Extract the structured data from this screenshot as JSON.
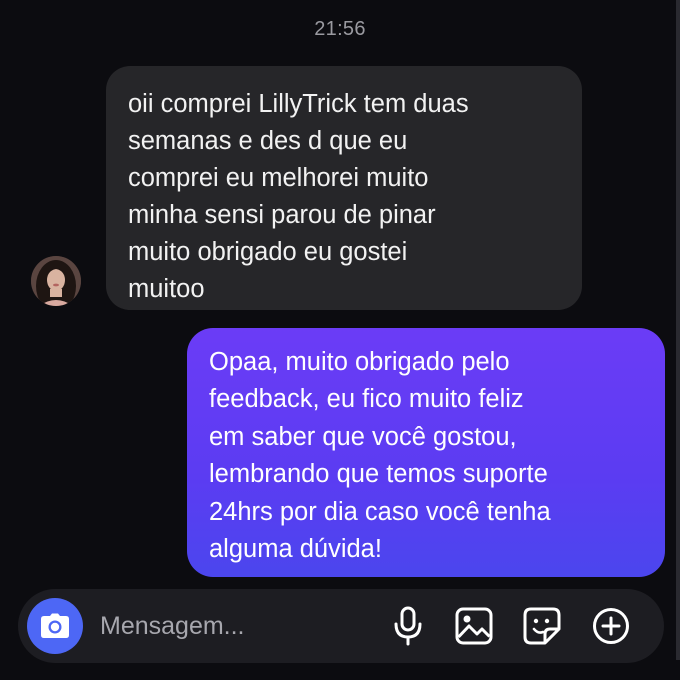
{
  "thread": {
    "timestamp": "21:56"
  },
  "messages": [
    {
      "direction": "incoming",
      "text": "oii comprei LillyTrick tem duas\nsemanas e des d que eu\ncomprei eu melhorei muito\nminha sensi parou de pinar\nmuito obrigado eu gostei\nmuitoo"
    },
    {
      "direction": "outgoing",
      "text": "Opaa, muito obrigado pelo\nfeedback, eu fico muito feliz\nem saber que você gostou,\nlembrando que temos suporte\n24hrs por dia caso você tenha\nalguma dúvida!"
    }
  ],
  "composer": {
    "placeholder": "Mensagem...",
    "value": "",
    "icons": [
      "camera-icon",
      "microphone-icon",
      "gallery-icon",
      "sticker-icon",
      "plus-icon"
    ]
  },
  "colors": {
    "background": "#0c0c10",
    "incoming_bubble": "#262629",
    "outgoing_bubble_top": "#6b3cf6",
    "outgoing_bubble_bottom": "#4b46ee",
    "camera_button": "#4d67f5"
  }
}
